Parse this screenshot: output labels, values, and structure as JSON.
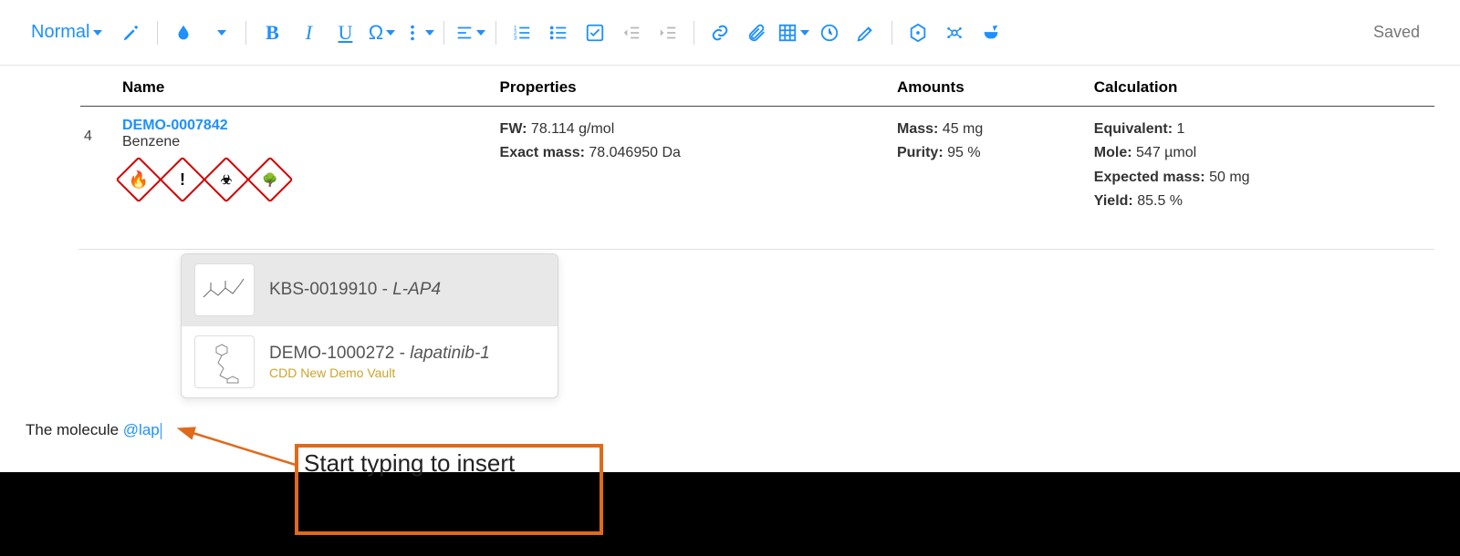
{
  "toolbar": {
    "style_label": "Normal",
    "saved_label": "Saved"
  },
  "table": {
    "headers": {
      "name": "Name",
      "properties": "Properties",
      "amounts": "Amounts",
      "calculation": "Calculation"
    },
    "row": {
      "index": "4",
      "compound_id": "DEMO-0007842",
      "compound_name": "Benzene",
      "props": {
        "fw_key": "FW:",
        "fw_val": "78.114 g/mol",
        "em_key": "Exact mass:",
        "em_val": "78.046950 Da"
      },
      "amounts": {
        "mass_key": "Mass:",
        "mass_val": "45 mg",
        "purity_key": "Purity:",
        "purity_val": "95 %"
      },
      "calc": {
        "eq_key": "Equivalent:",
        "eq_val": "1",
        "mole_key": "Mole:",
        "mole_val": "547 µmol",
        "emass_key": "Expected mass:",
        "emass_val": "50 mg",
        "yield_key": "Yield:",
        "yield_val": "85.5 %"
      }
    }
  },
  "autocomplete": {
    "items": [
      {
        "code": "KBS-0019910",
        "sep": " - ",
        "name": "L-AP4",
        "sub": ""
      },
      {
        "code": "DEMO-1000272",
        "sep": " - ",
        "name": "lapatinib-1",
        "sub": "CDD New Demo Vault"
      }
    ]
  },
  "editor": {
    "prefix": "The molecule ",
    "mention": "@lap"
  },
  "callout": {
    "text": "Start typing to insert"
  }
}
